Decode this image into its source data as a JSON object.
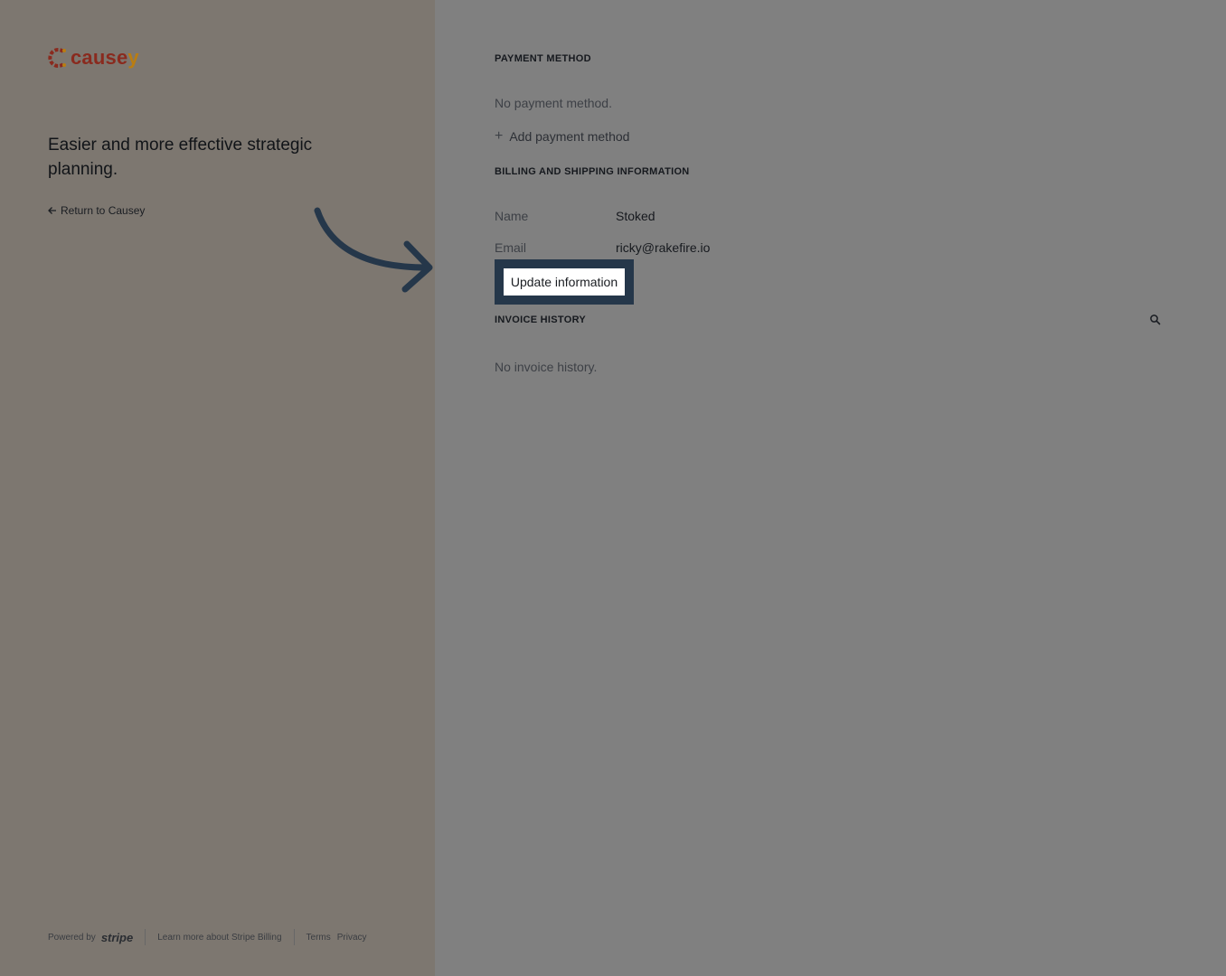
{
  "brand": {
    "name_main": "cause",
    "name_last": "y",
    "tagline": "Easier and more effective strategic planning.",
    "return_link": "Return to Causey"
  },
  "footer": {
    "powered_by": "Powered by",
    "stripe": "stripe",
    "learn_more": "Learn more about Stripe Billing",
    "terms": "Terms",
    "privacy": "Privacy"
  },
  "payment": {
    "heading": "PAYMENT METHOD",
    "empty": "No payment method.",
    "add_label": "Add payment method"
  },
  "billing": {
    "heading": "BILLING AND SHIPPING INFORMATION",
    "name_label": "Name",
    "name_value": "Stoked",
    "email_label": "Email",
    "email_value": "ricky@rakefire.io",
    "update_label": "Update information"
  },
  "invoices": {
    "heading": "INVOICE HISTORY",
    "empty": "No invoice history."
  },
  "colors": {
    "left_overlay": "#7d7770",
    "right_overlay": "#808080",
    "highlight": "#25374a",
    "brand_red": "#8a2a1e",
    "brand_gold": "#b97d12"
  }
}
